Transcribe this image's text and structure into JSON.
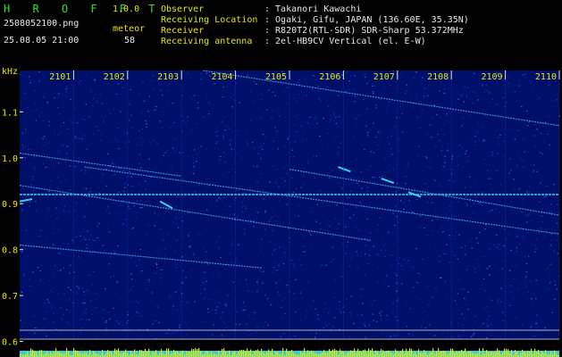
{
  "header": {
    "app_name": "H R O F F T",
    "version": "1.0.0",
    "filename": "2508052100.png",
    "datetime": "25.08.05 21:00",
    "meteor_label": "meteor",
    "meteor_count": "58",
    "info": [
      {
        "label": "Observer",
        "value": ": Takanori Kawachi"
      },
      {
        "label": "Receiving Location",
        "value": ": Ogaki, Gifu, JAPAN (136.60E, 35.35N)"
      },
      {
        "label": "Receiver",
        "value": ": R820T2(RTL-SDR) SDR-Sharp 53.372MHz"
      },
      {
        "label": "Receiving antenna",
        "value": ": 2el-HB9CV Vertical (el. E-W)"
      }
    ]
  },
  "colors": {
    "background": "#000000",
    "plot_noise": "#00106a",
    "signal": "#30e0f0",
    "axis_text": "#e8e800",
    "grid": "#e8e8e8",
    "activity_bars": "#e8e800",
    "activity_base": "#30d0e0"
  },
  "chart_data": {
    "type": "heatmap",
    "title": "",
    "ylabel": "kHz",
    "ylim": [
      0.6,
      1.2
    ],
    "yticks": [
      "1.1",
      "1.0",
      "0.9",
      "0.8",
      "0.7",
      "0.6"
    ],
    "xticks": [
      "2101",
      "2102",
      "2103",
      "2104",
      "2105",
      "2106",
      "2107",
      "2108",
      "2109",
      "2110"
    ],
    "continuous_tone_khz": 0.92,
    "drift_traces": [
      {
        "x_start": 2103.4,
        "y_start": 1.19,
        "x_end": 2110.0,
        "y_end": 1.07
      },
      {
        "x_start": 2100.0,
        "y_start": 1.01,
        "x_end": 2103.0,
        "y_end": 0.96
      },
      {
        "x_start": 2101.2,
        "y_start": 0.98,
        "x_end": 2110.0,
        "y_end": 0.834
      },
      {
        "x_start": 2105.0,
        "y_start": 0.975,
        "x_end": 2110.0,
        "y_end": 0.875
      },
      {
        "x_start": 2100.0,
        "y_start": 0.94,
        "x_end": 2106.5,
        "y_end": 0.82
      },
      {
        "x_start": 2100.0,
        "y_start": 0.81,
        "x_end": 2104.5,
        "y_end": 0.76
      }
    ],
    "meteor_echoes": [
      {
        "x": 2100.1,
        "y_start": 0.905,
        "y_end": 0.91
      },
      {
        "x": 2102.7,
        "y_start": 0.905,
        "y_end": 0.89
      },
      {
        "x": 2106.0,
        "y_start": 0.98,
        "y_end": 0.97
      },
      {
        "x": 2106.8,
        "y_start": 0.955,
        "y_end": 0.945
      },
      {
        "x": 2107.3,
        "y_start": 0.925,
        "y_end": 0.915
      }
    ]
  }
}
